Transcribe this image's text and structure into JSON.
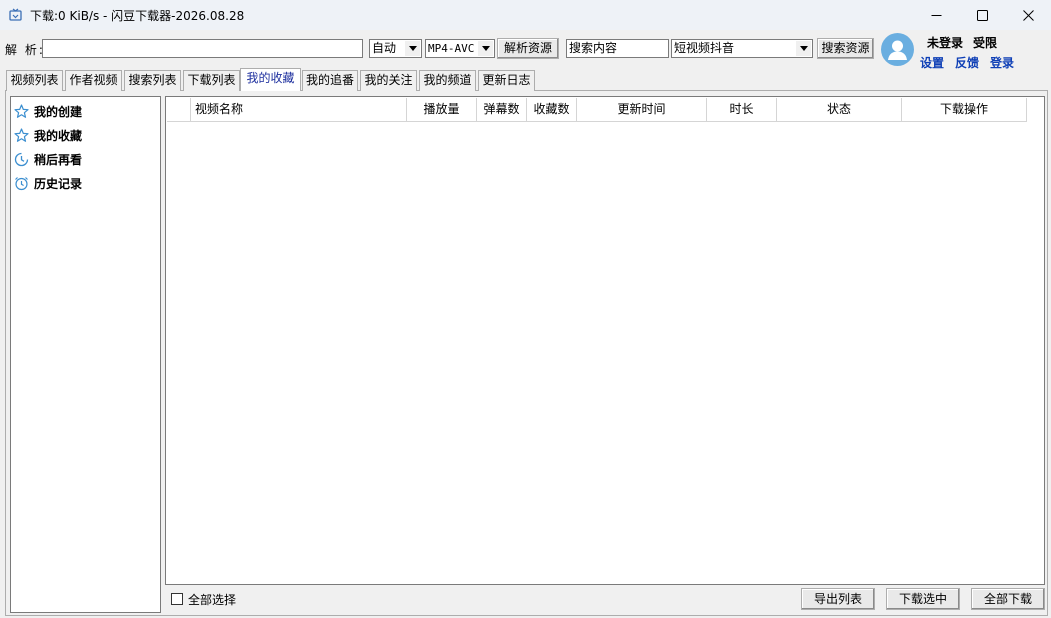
{
  "window": {
    "title": "下载:0 KiB/s - 闪豆下载器-2026.08.28",
    "minimize_icon": "minimize-icon",
    "maximize_icon": "maximize-icon",
    "close_icon": "close-icon"
  },
  "toolbar": {
    "parse_label": "解 析:",
    "url_value": "",
    "quality_selected": "自动",
    "format_selected": "MP4-AVC",
    "parse_button": "解析资源",
    "search_value": "搜索内容",
    "platform_selected": "短视频抖音",
    "search_button": "搜索资源"
  },
  "user": {
    "status_login": "未登录",
    "status_limit": "受限",
    "links": [
      "设置",
      "反馈",
      "登录"
    ],
    "accent_color": "#0e3fb6"
  },
  "tabs": [
    {
      "label": "视频列表"
    },
    {
      "label": "作者视频"
    },
    {
      "label": "搜索列表"
    },
    {
      "label": "下载列表"
    },
    {
      "label": "我的收藏",
      "active": true
    },
    {
      "label": "我的追番"
    },
    {
      "label": "我的关注"
    },
    {
      "label": "我的频道"
    },
    {
      "label": "更新日志"
    }
  ],
  "sidebar": {
    "items": [
      {
        "label": "我的创建",
        "icon": "star-icon"
      },
      {
        "label": "我的收藏",
        "icon": "star-icon"
      },
      {
        "label": "稍后再看",
        "icon": "clock-icon"
      },
      {
        "label": "历史记录",
        "icon": "alarm-clock-icon"
      }
    ]
  },
  "table": {
    "columns": [
      "",
      "视频名称",
      "播放量",
      "弹幕数",
      "收藏数",
      "更新时间",
      "时长",
      "状态",
      "下载操作"
    ],
    "rows": []
  },
  "footer": {
    "select_all_label": "全部选择",
    "export_button": "导出列表",
    "download_selected_button": "下载选中",
    "download_all_button": "全部下载"
  }
}
